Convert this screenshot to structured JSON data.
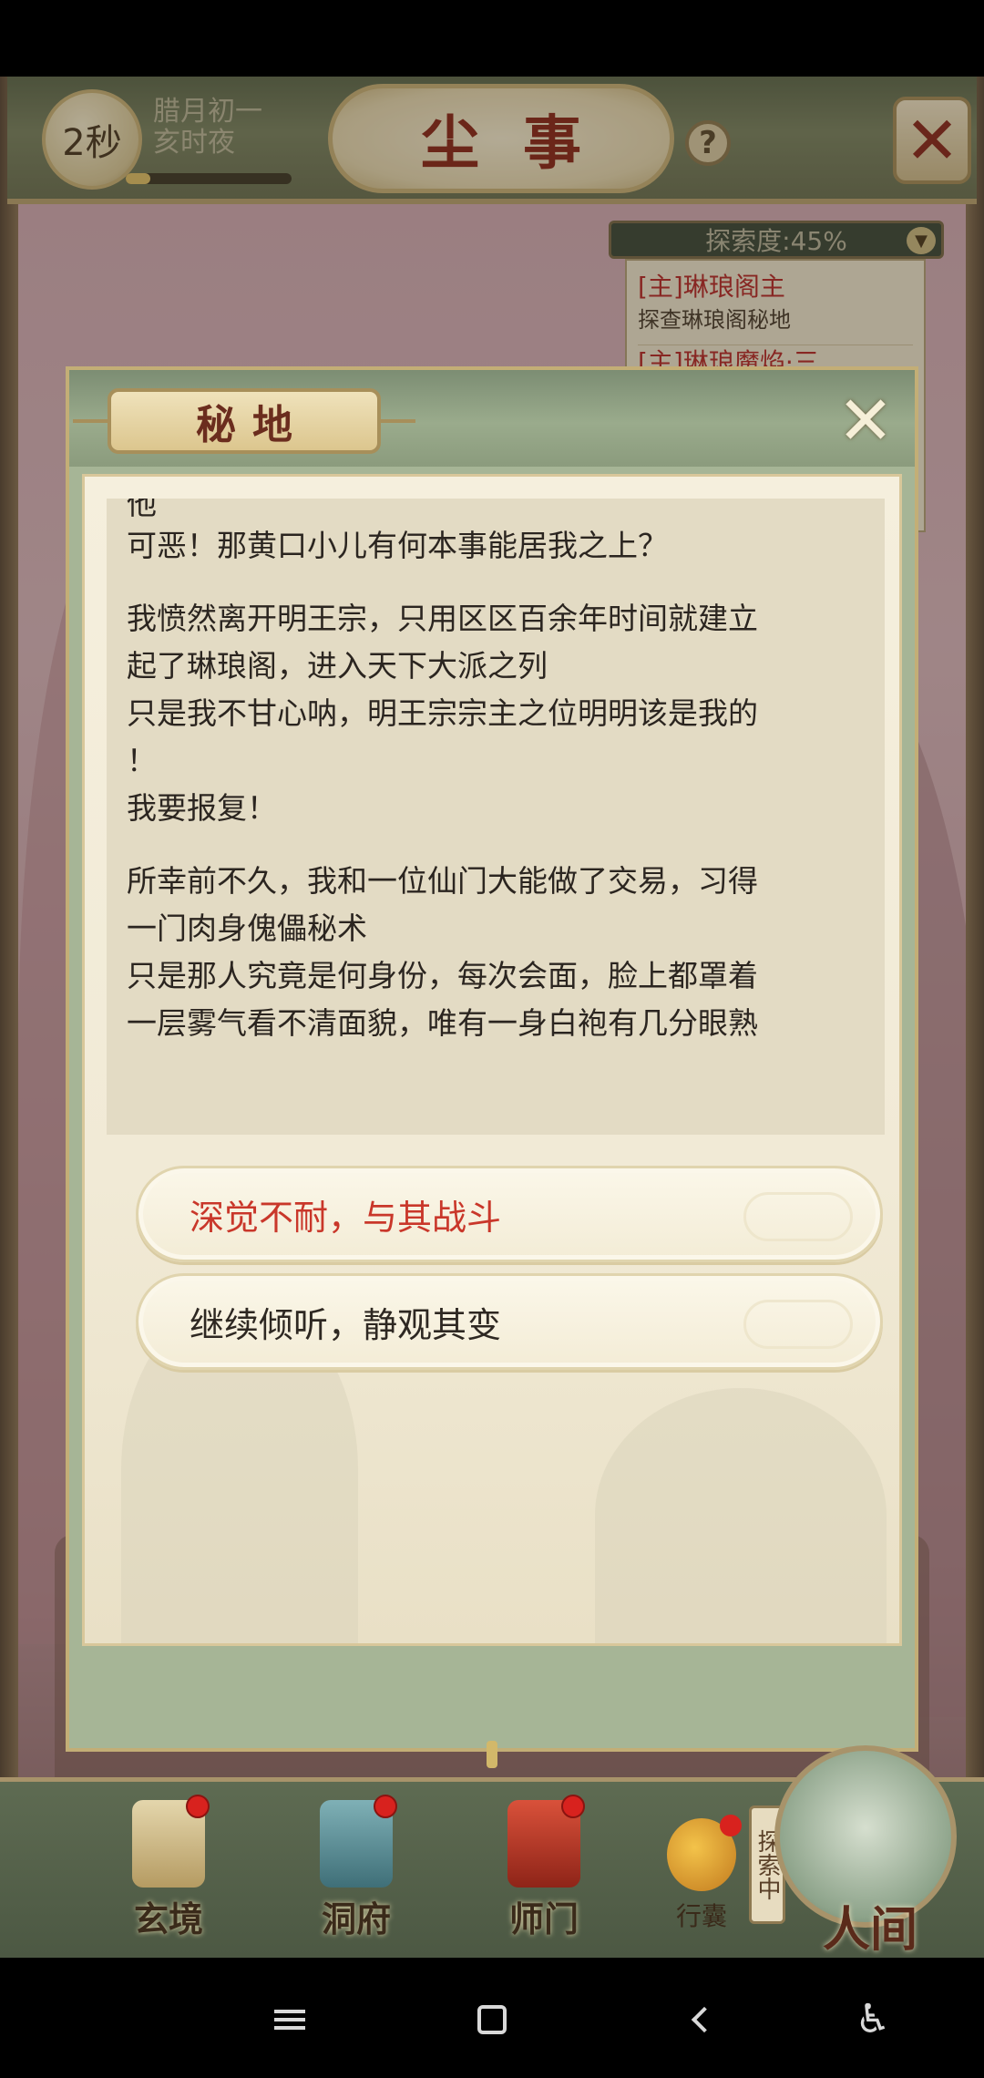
{
  "header": {
    "timer": "2秒",
    "date_line1": "腊月初一",
    "date_line2": "亥时夜",
    "title": "尘事",
    "help_icon": "question-icon",
    "close_icon": "close-x-icon"
  },
  "explore": {
    "progress_label": "探索度:45%",
    "progress_value": 0.45,
    "quests": [
      {
        "title": "[主]琳琅阁主",
        "desc": "探查琳琅阁秘地"
      },
      {
        "title": "[主]琳琅魔焰·三",
        "desc": ""
      }
    ]
  },
  "modal": {
    "title": "秘地",
    "cut_line": "他",
    "paragraphs": [
      [
        "可恶！那黄口小儿有何本事能居我之上？"
      ],
      [
        "我愤然离开明王宗，只用区区百余年时间就建立",
        "起了琳琅阁，进入天下大派之列",
        "只是我不甘心呐，明王宗宗主之位明明该是我的",
        "！",
        "我要报复！"
      ],
      [
        "所幸前不久，我和一位仙门大能做了交易，习得",
        "一门肉身傀儡秘术",
        "只是那人究竟是何身份，每次会面，脸上都罩着",
        "一层雾气看不清面貌，唯有一身白袍有几分眼熟"
      ]
    ],
    "choices": [
      {
        "label": "深觉不耐，与其战斗",
        "color": "#c9372a"
      },
      {
        "label": "继续倾听，静观其变",
        "color": "#2e2822"
      }
    ]
  },
  "bottom_nav": {
    "items": [
      {
        "label": "玄境",
        "icon": "scroll-icon",
        "badge": true
      },
      {
        "label": "洞府",
        "icon": "pavilion-icon",
        "badge": true
      },
      {
        "label": "师门",
        "icon": "banner-icon",
        "badge": true
      }
    ],
    "bag": {
      "label": "行囊",
      "icon": "bag-icon",
      "badge": true
    },
    "explore_tag": "探索中",
    "main": {
      "label": "人间",
      "icon": "world-disk-icon"
    }
  },
  "colors": {
    "accent_red": "#c9372a",
    "title_red": "#8b2a1d",
    "panel_green": "#7c8d73",
    "parchment": "#f5efdd"
  }
}
